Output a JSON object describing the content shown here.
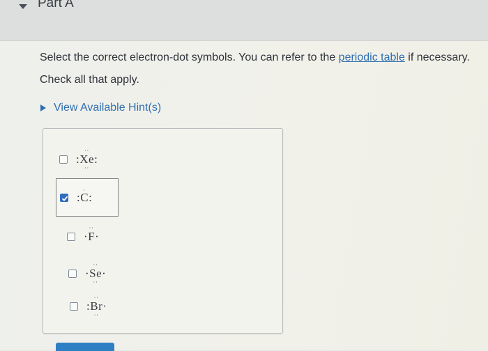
{
  "part": {
    "title": "Part A"
  },
  "question": {
    "instruction_before": "Select the correct electron-dot symbols. You can refer to the ",
    "link_text": "periodic table",
    "instruction_after": " if necessary.",
    "check_all": "Check all that apply."
  },
  "hint": {
    "label": "View Available Hint(s)"
  },
  "options": [
    {
      "left": ":",
      "element": "Xe",
      "right": ":",
      "top_dots": "··",
      "bottom_dots": "··",
      "checked": false
    },
    {
      "left": ":",
      "element": "C",
      "right": ":",
      "top_dots": "",
      "bottom_dots": "",
      "checked": true
    },
    {
      "left": "·",
      "element": "F",
      "right": "·",
      "top_dots": "··",
      "bottom_dots": "",
      "checked": false
    },
    {
      "left": "·",
      "element": "Se",
      "right": "·",
      "top_dots": "··",
      "bottom_dots": "··",
      "checked": false
    },
    {
      "left": ":",
      "element": "Br",
      "right": "·",
      "top_dots": "··",
      "bottom_dots": "··",
      "checked": false
    }
  ],
  "colors": {
    "link": "#2f6fb0",
    "checked_box": "#2f6cc0",
    "submit_button": "#2f7fc4"
  }
}
